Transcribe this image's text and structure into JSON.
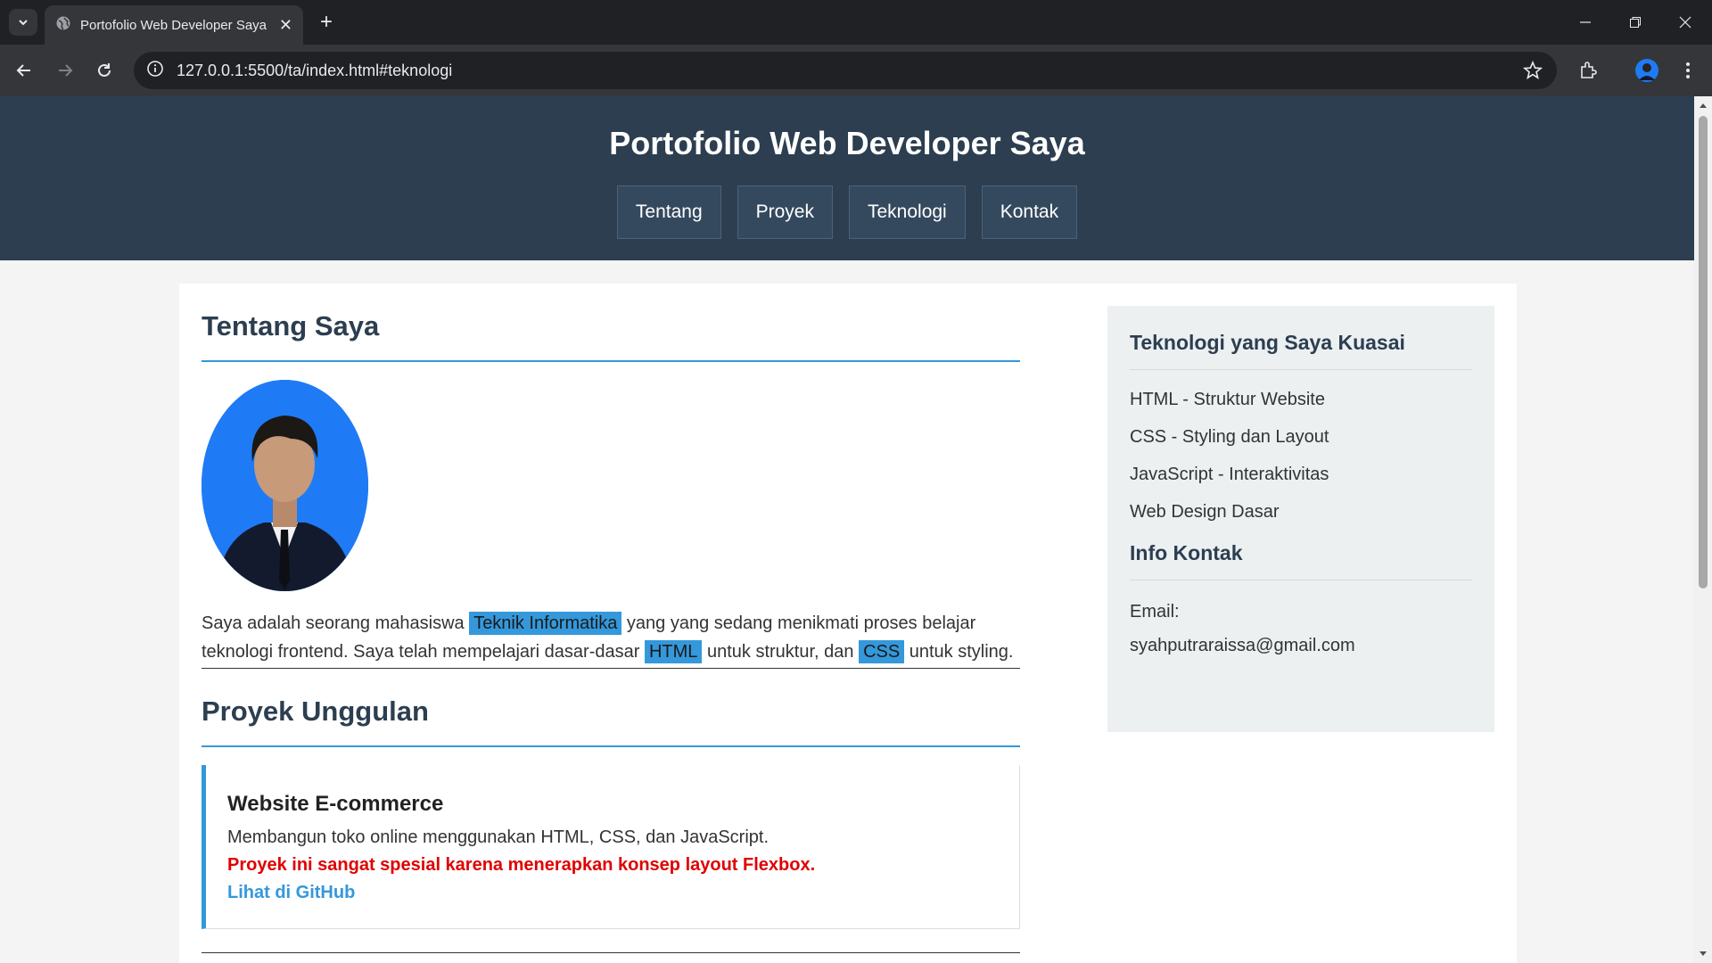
{
  "browser": {
    "tab_title": "Portofolio Web Developer Saya",
    "url": "127.0.0.1:5500/ta/index.html#teknologi"
  },
  "site": {
    "title": "Portofolio Web Developer Saya",
    "nav": [
      "Tentang",
      "Proyek",
      "Teknologi",
      "Kontak"
    ]
  },
  "about": {
    "title": "Tentang Saya",
    "text_1": "Saya adalah seorang mahasiswa ",
    "hl_1": "Teknik Informatika",
    "text_2": " yang yang sedang menikmati proses belajar teknologi frontend. Saya telah mempelajari dasar-dasar ",
    "hl_2": "HTML",
    "text_3": " untuk struktur, dan ",
    "hl_3": "CSS",
    "text_4": " untuk styling."
  },
  "projects": {
    "title": "Proyek Unggulan",
    "items": [
      {
        "name": "Website E-commerce",
        "description": "Membangun toko online menggunakan HTML, CSS, dan JavaScript.",
        "special": "Proyek ini sangat spesial karena menerapkan konsep layout Flexbox.",
        "link": "Lihat di GitHub"
      }
    ]
  },
  "sidebar": {
    "tech_title": "Teknologi yang Saya Kuasai",
    "tech_items": [
      "HTML - Struktur Website",
      "CSS - Styling dan Layout",
      "JavaScript - Interaktivitas",
      "Web Design Dasar"
    ],
    "contact_title": "Info Kontak",
    "contact_label": "Email:",
    "contact_email": "syahputraraissa@gmail.com"
  },
  "colors": {
    "header_bg": "#2c3e50",
    "accent": "#3498db",
    "highlight_red": "#e00000",
    "sidebar_bg": "#ecf0f1"
  },
  "icons": [
    "tab-search-icon",
    "globe-icon",
    "close-icon",
    "plus-icon",
    "minimize-icon",
    "restore-icon",
    "window-close-icon",
    "back-arrow-icon",
    "forward-arrow-icon",
    "reload-icon",
    "site-info-icon",
    "bookmark-star-icon",
    "extensions-icon",
    "profile-avatar-icon",
    "menu-dots-icon"
  ]
}
